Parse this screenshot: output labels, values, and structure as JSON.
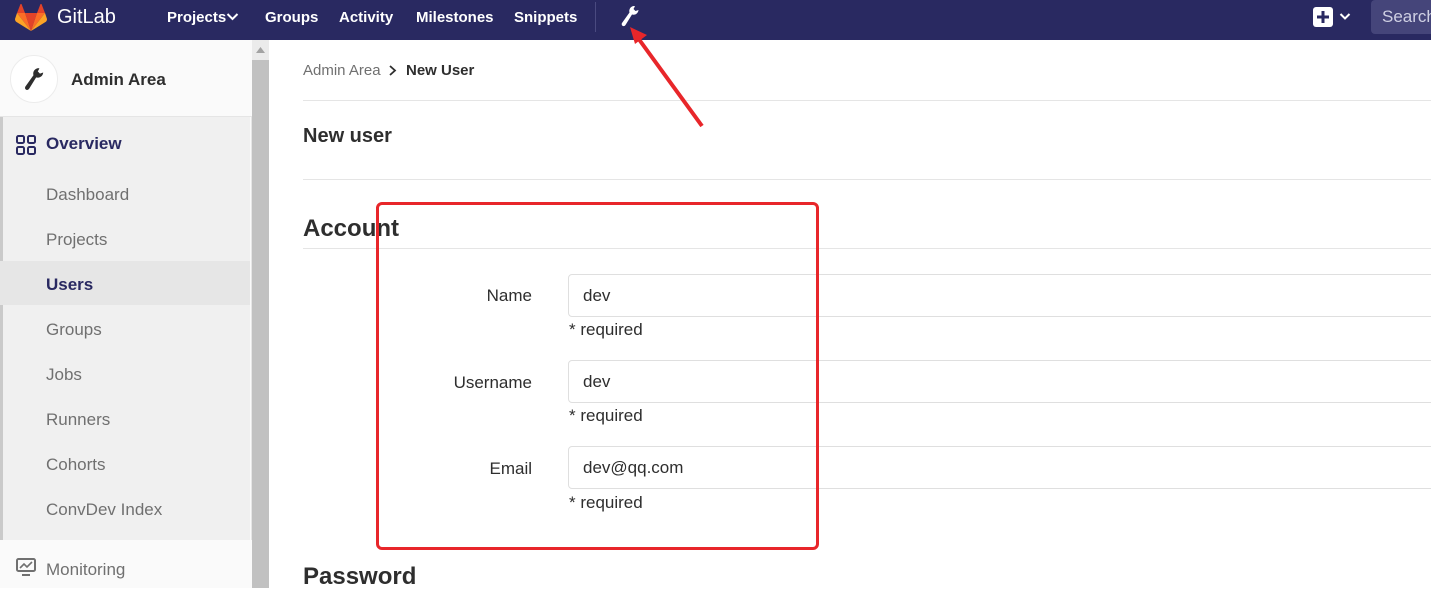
{
  "navbar": {
    "brand": "GitLab",
    "items": [
      "Projects",
      "Groups",
      "Activity",
      "Milestones",
      "Snippets"
    ],
    "search_placeholder": "Search",
    "colors": {
      "background": "#292961",
      "logo_orange": "#fc6d26"
    }
  },
  "sidebar": {
    "context_title": "Admin Area",
    "overview_label": "Overview",
    "items": [
      "Dashboard",
      "Projects",
      "Users",
      "Groups",
      "Jobs",
      "Runners",
      "Cohorts",
      "ConvDev Index"
    ],
    "active_item": "Users",
    "monitoring_label": "Monitoring"
  },
  "breadcrumb": {
    "parent": "Admin Area",
    "current": "New User"
  },
  "page": {
    "title": "New user",
    "account_section": "Account",
    "password_section": "Password",
    "fields": {
      "name": {
        "label": "Name",
        "value": "dev",
        "hint": "* required"
      },
      "username": {
        "label": "Username",
        "value": "dev",
        "hint": "* required"
      },
      "email": {
        "label": "Email",
        "value": "dev@qq.com",
        "hint": "* required"
      }
    }
  },
  "annotation": {
    "color": "#e8262a"
  }
}
